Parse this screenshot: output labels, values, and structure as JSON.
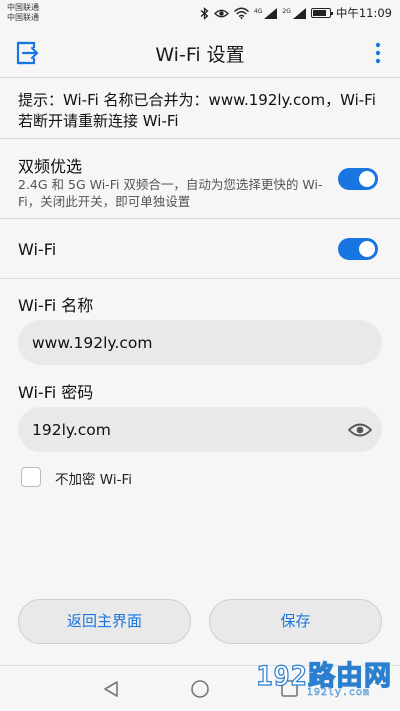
{
  "status_bar": {
    "carrier_1": "中国联通",
    "carrier_2": "中国联通",
    "sig1_label": "4G",
    "sig2_label": "2G",
    "time": "中午11:09",
    "battery_level": 0.85
  },
  "toolbar": {
    "title": "Wi-Fi 设置",
    "back_icon": "exit-icon",
    "more_icon": "more-vertical-icon"
  },
  "notice": {
    "text": "提示：Wi-Fi 名称已合并为：www.192ly.com，Wi-Fi 若断开请重新连接 Wi-Fi"
  },
  "dual_band": {
    "title": "双频优选",
    "description": "2.4G 和 5G Wi-Fi 双频合一，自动为您选择更快的 Wi-Fi，关闭此开关，即可单独设置",
    "enabled": true
  },
  "wifi": {
    "title": "Wi-Fi",
    "enabled": true
  },
  "ssid": {
    "label": "Wi-Fi 名称",
    "value": "www.192ly.com"
  },
  "password": {
    "label": "Wi-Fi 密码",
    "value": "192ly.com"
  },
  "no_password": {
    "label": "不加密 Wi-Fi",
    "checked": false
  },
  "buttons": {
    "back_home": "返回主界面",
    "save": "保存"
  },
  "watermark": {
    "main": "192路由网",
    "sub": "192ly.com"
  },
  "colors": {
    "accent": "#1976e0",
    "background": "#f6f6f6",
    "field_bg": "#e9e9e9"
  }
}
